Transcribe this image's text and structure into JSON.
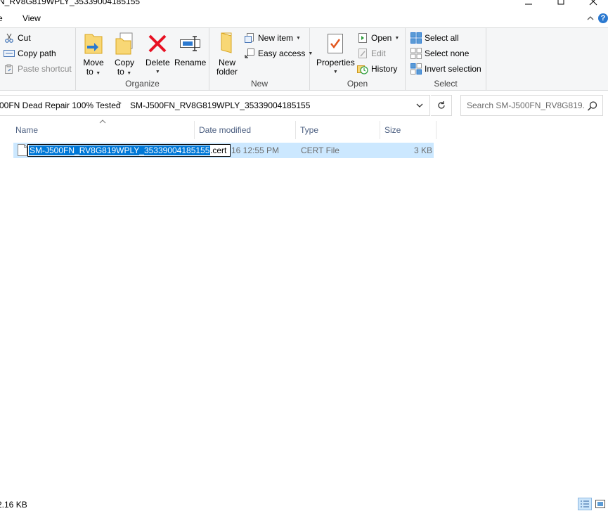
{
  "window": {
    "title": "N_RV8G819WPLY_35339004185155"
  },
  "tabs": [
    {
      "label": "e"
    },
    {
      "label": "View"
    }
  ],
  "ribbon": {
    "clipboard": {
      "cut": "Cut",
      "copy_path": "Copy path",
      "paste_shortcut": "Paste shortcut"
    },
    "organize": {
      "label": "Organize",
      "move_to_line1": "Move",
      "move_to_line2": "to",
      "copy_to_line1": "Copy",
      "copy_to_line2": "to",
      "delete": "Delete",
      "rename": "Rename"
    },
    "new": {
      "label": "New",
      "new_folder_line1": "New",
      "new_folder_line2": "folder",
      "new_item": "New item",
      "easy_access": "Easy access"
    },
    "open": {
      "label": "Open",
      "properties": "Properties",
      "open": "Open",
      "edit": "Edit",
      "history": "History"
    },
    "select": {
      "label": "Select",
      "select_all": "Select all",
      "select_none": "Select none",
      "invert_selection": "Invert selection"
    }
  },
  "address": {
    "crumb1": "00FN Dead Repair 100% Tested",
    "crumb2": "SM-J500FN_RV8G819WPLY_35339004185155"
  },
  "search": {
    "placeholder": "Search SM-J500FN_RV8G819..."
  },
  "columns": {
    "name": "Name",
    "date_modified": "Date modified",
    "type": "Type",
    "size": "Size"
  },
  "files": [
    {
      "name_selected": "SM-J500FN_RV8G819WPLY_35339004185155",
      "name_ext": ".cert",
      "date_modified": "16 12:55 PM",
      "type": "CERT File",
      "size": "3 KB"
    }
  ],
  "status": {
    "text": "2.16 KB"
  },
  "colors": {
    "selection_row": "#cce8ff",
    "text_selection": "#0078d7",
    "ribbon_bg": "#f5f6f7",
    "column_header_text": "#4d6082",
    "delete_red": "#e81123",
    "folder_yellow": "#f8d775"
  }
}
